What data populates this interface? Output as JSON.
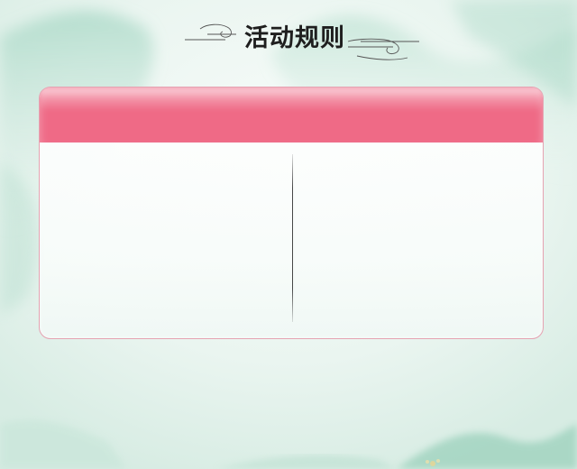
{
  "header": {
    "title": "活动规则"
  },
  "colors": {
    "header_bar": "#ef6a86",
    "panel_border": "#e5a3b2",
    "background": "#e7f3ee",
    "title_text": "#1e1e1e"
  },
  "icons": {
    "title_left_ornament": "cloud-scroll-ornament",
    "title_right_ornament": "cloud-scroll-ornament"
  }
}
